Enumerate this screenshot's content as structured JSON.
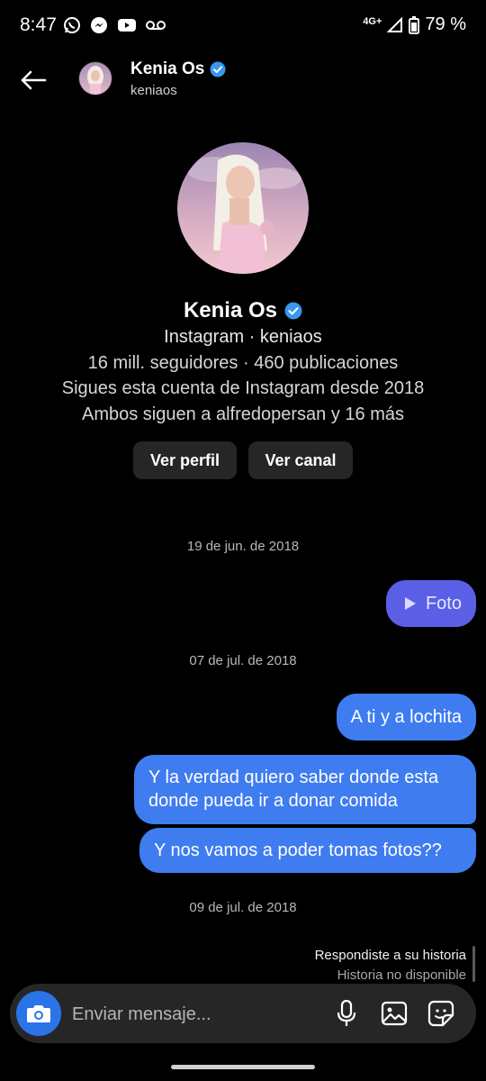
{
  "status_bar": {
    "time": "8:47",
    "network": "4G+",
    "battery": "79 %"
  },
  "header": {
    "name": "Kenia Os",
    "username": "keniaos"
  },
  "profile": {
    "name": "Kenia Os",
    "line1": "Instagram · keniaos",
    "line2": "16 mill. seguidores · 460 publicaciones",
    "line3": "Sigues esta cuenta de Instagram desde 2018",
    "line4": "Ambos siguen a alfredopersan y 16 más",
    "btn_profile": "Ver perfil",
    "btn_channel": "Ver canal"
  },
  "messages": {
    "date1": "19 de jun. de 2018",
    "photo_label": "Foto",
    "date2": "07 de jul. de 2018",
    "msg1": "A ti y a lochita",
    "msg2_line1": "Y la verdad quiero saber donde esta",
    "msg2_line2": "donde pueda ir a donar comida",
    "msg3": "Y nos vamos a poder tomas fotos??",
    "date3": "09 de jul. de 2018",
    "story_reply_title": "Respondiste a su historia",
    "story_reply_sub": "Historia no disponible"
  },
  "composer": {
    "placeholder": "Enviar mensaje..."
  },
  "colors": {
    "background": "#000000",
    "sent_bubble": "#3f7cf0",
    "photo_bubble": "#5a5fe6",
    "verified": "#3897f0",
    "camera_button": "#2a74e8"
  }
}
